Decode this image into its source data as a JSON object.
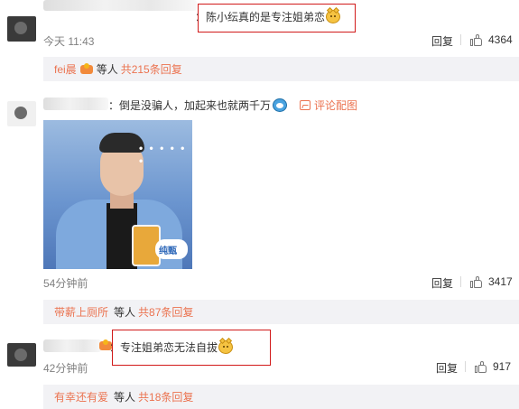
{
  "comments": [
    {
      "separator": "：",
      "text": "陈小纭真的是专注姐弟恋",
      "emoji": "smiling-cat-emoji",
      "time": "今天 11:43",
      "reply_label": "回复",
      "likes": "4364",
      "sub_replies": {
        "user": "fei晨",
        "middle": "等人",
        "count_text": "共215条回复"
      }
    },
    {
      "separator": "：",
      "text": "倒是没骗人，加起来也就两千万",
      "emoji": "doraemon-emoji",
      "image_comment_label": "评论配图",
      "time": "54分钟前",
      "reply_label": "回复",
      "likes": "3417",
      "image_overlay": "• • • • • •",
      "image_brand": "纯甄",
      "sub_replies": {
        "user": "带薪上厕所",
        "middle": "等人",
        "count_text": "共87条回复"
      }
    },
    {
      "separator": "：",
      "text": "专注姐弟恋无法自拔",
      "emoji": "smiling-cat-emoji",
      "time": "42分钟前",
      "reply_label": "回复",
      "likes": "917",
      "sub_replies": {
        "user": "有幸还有爱",
        "middle": "等人",
        "count_text": "共18条回复"
      }
    }
  ],
  "colors": {
    "accent": "#eb7350",
    "highlight_box": "#d11a1a",
    "muted": "#808080",
    "reply_bg": "#f2f2f5"
  }
}
